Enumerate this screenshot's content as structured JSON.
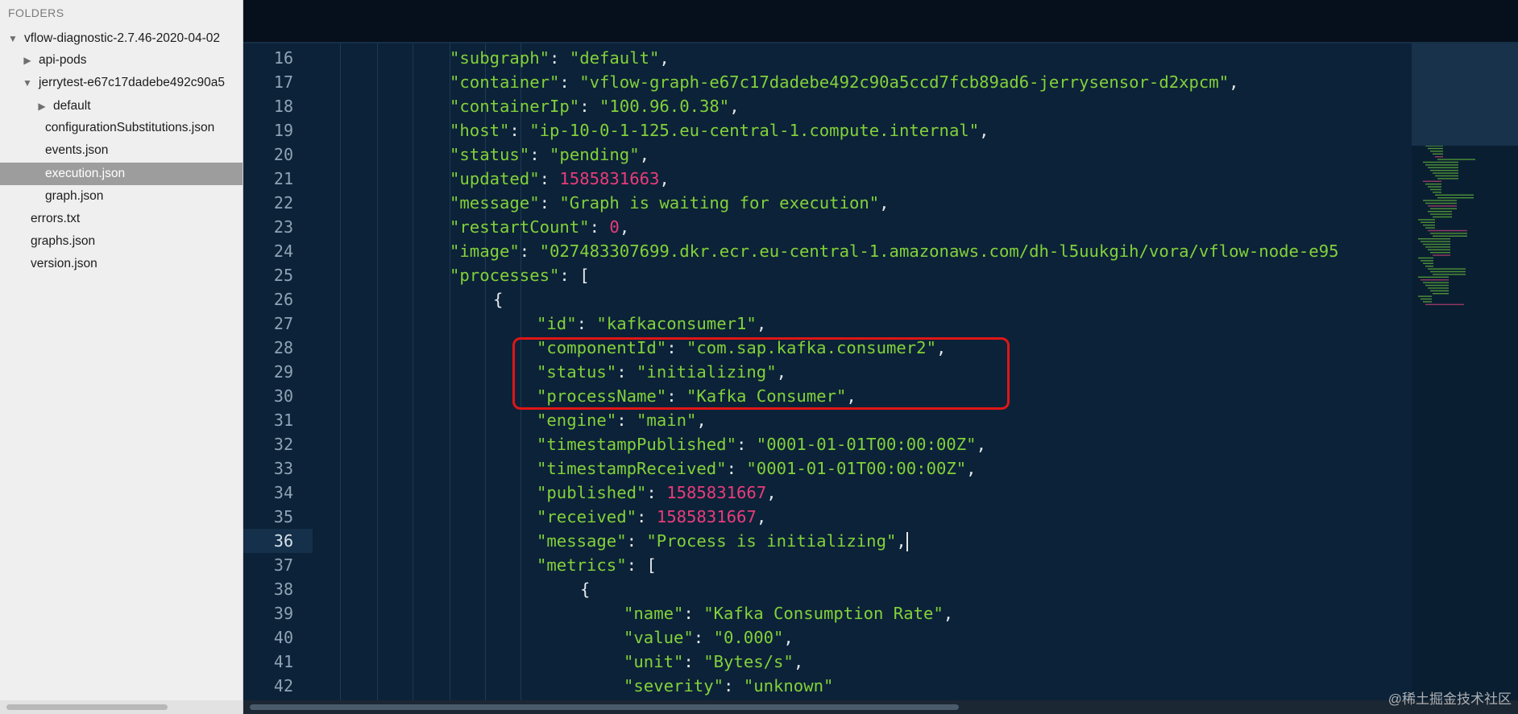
{
  "sidebar": {
    "title": "FOLDERS",
    "items": [
      {
        "label": "vflow-diagnostic-2.7.46-2020-04-02",
        "toggle": "▼"
      },
      {
        "label": "api-pods",
        "toggle": "▶"
      },
      {
        "label": "jerrytest-e67c17dadebe492c90a5",
        "toggle": "▼"
      },
      {
        "label": "default",
        "toggle": "▶"
      },
      {
        "label": "configurationSubstitutions.json",
        "toggle": ""
      },
      {
        "label": "events.json",
        "toggle": ""
      },
      {
        "label": "execution.json",
        "toggle": ""
      },
      {
        "label": "graph.json",
        "toggle": ""
      },
      {
        "label": "errors.txt",
        "toggle": ""
      },
      {
        "label": "graphs.json",
        "toggle": ""
      },
      {
        "label": "version.json",
        "toggle": ""
      }
    ],
    "selected_index": 6
  },
  "editor": {
    "active_line": "36",
    "line_numbers": [
      "16",
      "17",
      "18",
      "19",
      "20",
      "21",
      "22",
      "23",
      "24",
      "25",
      "26",
      "27",
      "28",
      "29",
      "30",
      "31",
      "32",
      "33",
      "34",
      "35",
      "36",
      "37",
      "38",
      "39",
      "40",
      "41",
      "42"
    ],
    "lines": [
      [
        {
          "t": "\"subgraph\"",
          "c": "key"
        },
        {
          "t": ": ",
          "c": "punct"
        },
        {
          "t": "\"default\"",
          "c": "str"
        },
        {
          "t": ",",
          "c": "punct"
        }
      ],
      [
        {
          "t": "\"container\"",
          "c": "key"
        },
        {
          "t": ": ",
          "c": "punct"
        },
        {
          "t": "\"vflow-graph-e67c17dadebe492c90a5ccd7fcb89ad6-jerrysensor-d2xpcm\"",
          "c": "str"
        },
        {
          "t": ",",
          "c": "punct"
        }
      ],
      [
        {
          "t": "\"containerIp\"",
          "c": "key"
        },
        {
          "t": ": ",
          "c": "punct"
        },
        {
          "t": "\"100.96.0.38\"",
          "c": "str"
        },
        {
          "t": ",",
          "c": "punct"
        }
      ],
      [
        {
          "t": "\"host\"",
          "c": "key"
        },
        {
          "t": ": ",
          "c": "punct"
        },
        {
          "t": "\"ip-10-0-1-125.eu-central-1.compute.internal\"",
          "c": "str"
        },
        {
          "t": ",",
          "c": "punct"
        }
      ],
      [
        {
          "t": "\"status\"",
          "c": "key"
        },
        {
          "t": ": ",
          "c": "punct"
        },
        {
          "t": "\"pending\"",
          "c": "str"
        },
        {
          "t": ",",
          "c": "punct"
        }
      ],
      [
        {
          "t": "\"updated\"",
          "c": "key"
        },
        {
          "t": ": ",
          "c": "punct"
        },
        {
          "t": "1585831663",
          "c": "num"
        },
        {
          "t": ",",
          "c": "punct"
        }
      ],
      [
        {
          "t": "\"message\"",
          "c": "key"
        },
        {
          "t": ": ",
          "c": "punct"
        },
        {
          "t": "\"Graph is waiting for execution\"",
          "c": "str"
        },
        {
          "t": ",",
          "c": "punct"
        }
      ],
      [
        {
          "t": "\"restartCount\"",
          "c": "key"
        },
        {
          "t": ": ",
          "c": "punct"
        },
        {
          "t": "0",
          "c": "num"
        },
        {
          "t": ",",
          "c": "punct"
        }
      ],
      [
        {
          "t": "\"image\"",
          "c": "key"
        },
        {
          "t": ": ",
          "c": "punct"
        },
        {
          "t": "\"027483307699.dkr.ecr.eu-central-1.amazonaws.com/dh-l5uukgih/vora/vflow-node-e95",
          "c": "str"
        }
      ],
      [
        {
          "t": "\"processes\"",
          "c": "key"
        },
        {
          "t": ": [",
          "c": "punct"
        }
      ],
      [
        {
          "t": "{",
          "c": "punct"
        }
      ],
      [
        {
          "t": "\"id\"",
          "c": "key"
        },
        {
          "t": ": ",
          "c": "punct"
        },
        {
          "t": "\"kafkaconsumer1\"",
          "c": "str"
        },
        {
          "t": ",",
          "c": "punct"
        }
      ],
      [
        {
          "t": "\"componentId\"",
          "c": "key"
        },
        {
          "t": ": ",
          "c": "punct"
        },
        {
          "t": "\"com.sap.kafka.consumer2\"",
          "c": "str"
        },
        {
          "t": ",",
          "c": "punct"
        }
      ],
      [
        {
          "t": "\"status\"",
          "c": "key"
        },
        {
          "t": ": ",
          "c": "punct"
        },
        {
          "t": "\"initializing\"",
          "c": "str"
        },
        {
          "t": ",",
          "c": "punct"
        }
      ],
      [
        {
          "t": "\"processName\"",
          "c": "key"
        },
        {
          "t": ": ",
          "c": "punct"
        },
        {
          "t": "\"Kafka Consumer\"",
          "c": "str"
        },
        {
          "t": ",",
          "c": "punct"
        }
      ],
      [
        {
          "t": "\"engine\"",
          "c": "key"
        },
        {
          "t": ": ",
          "c": "punct"
        },
        {
          "t": "\"main\"",
          "c": "str"
        },
        {
          "t": ",",
          "c": "punct"
        }
      ],
      [
        {
          "t": "\"timestampPublished\"",
          "c": "key"
        },
        {
          "t": ": ",
          "c": "punct"
        },
        {
          "t": "\"0001-01-01T00:00:00Z\"",
          "c": "str"
        },
        {
          "t": ",",
          "c": "punct"
        }
      ],
      [
        {
          "t": "\"timestampReceived\"",
          "c": "key"
        },
        {
          "t": ": ",
          "c": "punct"
        },
        {
          "t": "\"0001-01-01T00:00:00Z\"",
          "c": "str"
        },
        {
          "t": ",",
          "c": "punct"
        }
      ],
      [
        {
          "t": "\"published\"",
          "c": "key"
        },
        {
          "t": ": ",
          "c": "punct"
        },
        {
          "t": "1585831667",
          "c": "num"
        },
        {
          "t": ",",
          "c": "punct"
        }
      ],
      [
        {
          "t": "\"received\"",
          "c": "key"
        },
        {
          "t": ": ",
          "c": "punct"
        },
        {
          "t": "1585831667",
          "c": "num"
        },
        {
          "t": ",",
          "c": "punct"
        }
      ],
      [
        {
          "t": "\"message\"",
          "c": "key"
        },
        {
          "t": ": ",
          "c": "punct"
        },
        {
          "t": "\"Process is initializing\"",
          "c": "str"
        },
        {
          "t": ",",
          "c": "punct"
        }
      ],
      [
        {
          "t": "\"metrics\"",
          "c": "key"
        },
        {
          "t": ": [",
          "c": "punct"
        }
      ],
      [
        {
          "t": "{",
          "c": "punct"
        }
      ],
      [
        {
          "t": "\"name\"",
          "c": "key"
        },
        {
          "t": ": ",
          "c": "punct"
        },
        {
          "t": "\"Kafka Consumption Rate\"",
          "c": "str"
        },
        {
          "t": ",",
          "c": "punct"
        }
      ],
      [
        {
          "t": "\"value\"",
          "c": "key"
        },
        {
          "t": ": ",
          "c": "punct"
        },
        {
          "t": "\"0.000\"",
          "c": "str"
        },
        {
          "t": ",",
          "c": "punct"
        }
      ],
      [
        {
          "t": "\"unit\"",
          "c": "key"
        },
        {
          "t": ": ",
          "c": "punct"
        },
        {
          "t": "\"Bytes/s\"",
          "c": "str"
        },
        {
          "t": ",",
          "c": "punct"
        }
      ],
      [
        {
          "t": "\"severity\"",
          "c": "key"
        },
        {
          "t": ": ",
          "c": "punct"
        },
        {
          "t": "\"unknown\"",
          "c": "str"
        }
      ]
    ]
  },
  "colors": {
    "editor_bg": "#0c2238",
    "key": "#82d13a",
    "number": "#e83c7a",
    "punctuation": "#e3e8ec",
    "highlight_box": "#e01616",
    "sidebar_selected": "#9d9d9d"
  },
  "watermark": "@稀土掘金技术社区"
}
